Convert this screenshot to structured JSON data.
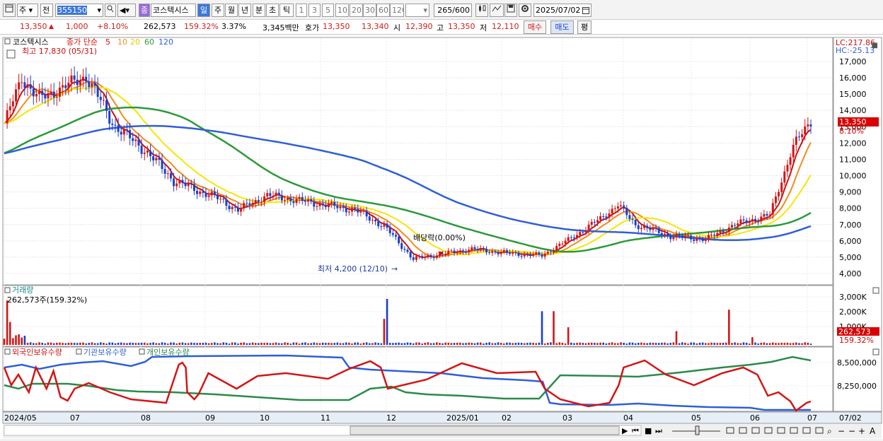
{
  "toolbar": {
    "market_select": "주",
    "prev_label": "전",
    "stock_code": "355150",
    "stock_name": "코스텍시스",
    "name_prefix": "종",
    "period_tabs": [
      "일",
      "주",
      "월",
      "년",
      "분",
      "초",
      "틱"
    ],
    "intervals": [
      "1",
      "3",
      "5",
      "10",
      "20",
      "30",
      "60",
      "120"
    ],
    "range_count": "265",
    "range_total": "/600",
    "date": "2025/07/02"
  },
  "price_bar": {
    "price": "13,350",
    "change": "1,000",
    "change_pct": "+8.10%",
    "volume": "262,573",
    "volume_ratio": "159.32%",
    "turnover_pct": "3.37%",
    "trade_amount": "3,345백만",
    "quote_label": "호가",
    "ask": "13,350",
    "bid": "13,340",
    "open_label": "시",
    "open": "12,390",
    "high_label": "고",
    "high": "13,350",
    "low_label": "저",
    "low": "12,110",
    "buy_label": "매수",
    "sell_label": "매도",
    "eval_label": "평"
  },
  "main_panel": {
    "stock_name": "코스텍시스",
    "legend_prefix": "종가 단순",
    "ma_periods": [
      "5",
      "10",
      "20",
      "60",
      "120"
    ],
    "ma_colors": [
      "#cc1111",
      "#f08c1a",
      "#f5e600",
      "#2b9a3a",
      "#2f5fd8"
    ],
    "high_note": "최고 17,830 (05/31)",
    "low_note": "최저 4,200 (12/10)",
    "dividend_note": "배당락(0.00%)",
    "lc": "LC:217.86",
    "hc": "HC:-25.13",
    "last_price": "13,350",
    "last_pct": "8.10%"
  },
  "volume_panel": {
    "title": "거래량",
    "summary": "262,573주(159.32%)",
    "last_volume": "262,573",
    "last_pct": "159.32%",
    "axis": [
      "3,000K",
      "2,000K",
      "1,000K"
    ]
  },
  "holdings_panel": {
    "foreign_label": "외국인보유수량",
    "inst_label": "기관보유수량",
    "indiv_label": "개인보유수량",
    "axis": [
      "8,500,000",
      "8,250,000"
    ]
  },
  "time_axis": [
    "2024/05",
    "07",
    "08",
    "09",
    "10",
    "11",
    "12",
    "2025/01",
    "02",
    "03",
    "04",
    "05",
    "06",
    "07"
  ],
  "cursor_date": "07/02",
  "chart_data": {
    "type": "line",
    "price_axis": [
      "17,000",
      "16,000",
      "15,000",
      "14,000",
      "13,000",
      "12,000",
      "11,000",
      "10,000",
      "9,000",
      "8,000",
      "7,000",
      "6,000",
      "5,000",
      "4,000"
    ],
    "price_range": [
      3900,
      17800
    ],
    "close_x": [
      0,
      6,
      12,
      20,
      28,
      38,
      48,
      58,
      66,
      72,
      80,
      90,
      100,
      110,
      120,
      130,
      140,
      150,
      160,
      172,
      184,
      196,
      205,
      210,
      216,
      228,
      240,
      250,
      262,
      270,
      276
    ],
    "close": [
      13200,
      16000,
      14700,
      15400,
      16100,
      13000,
      11600,
      9700,
      9100,
      8700,
      7900,
      8800,
      8500,
      8200,
      7900,
      6900,
      4900,
      5200,
      5500,
      5250,
      5100,
      6400,
      7500,
      8200,
      7000,
      6300,
      6100,
      7000,
      7600,
      11800,
      13350
    ]
  }
}
